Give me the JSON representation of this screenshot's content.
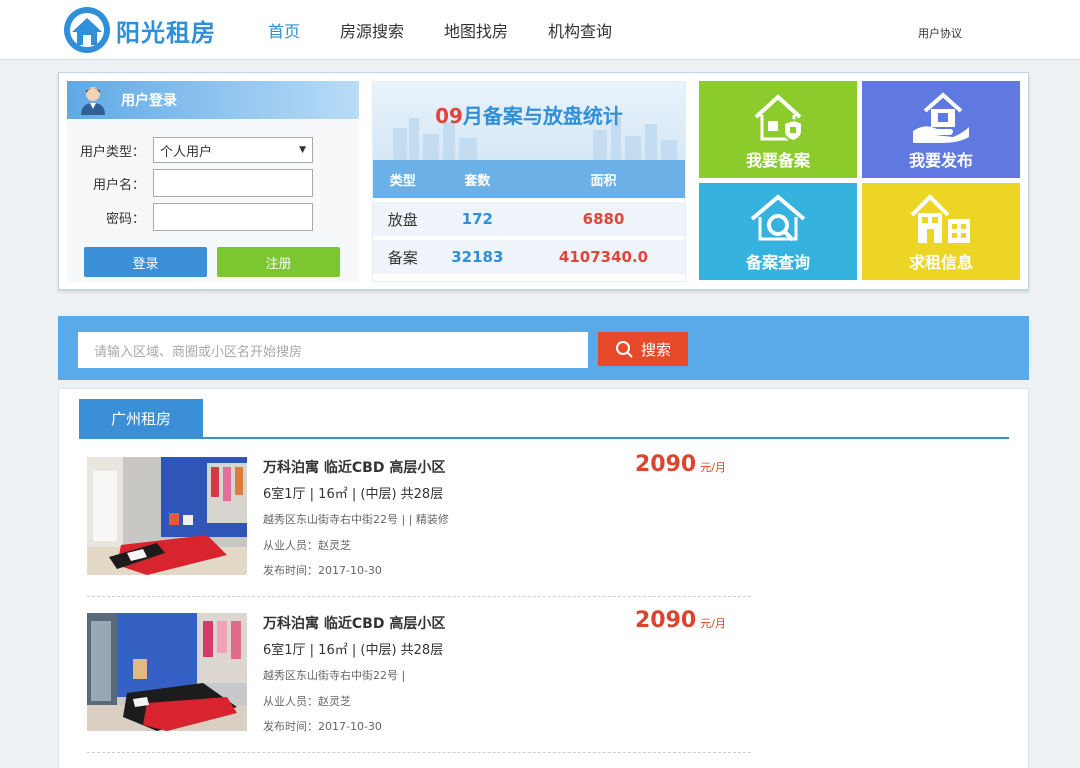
{
  "header": {
    "logo_text": "阳光租房",
    "nav": [
      "首页",
      "房源搜索",
      "地图找房",
      "机构查询"
    ],
    "agreement": "用户协议"
  },
  "login": {
    "title": "用户登录",
    "type_label": "用户类型：",
    "type_value": "个人用户",
    "username_label": "用户名：",
    "password_label": "密码：",
    "login_button": "登录",
    "register_button": "注册"
  },
  "stats": {
    "month": "09",
    "title_rest": "月备案与放盘统计",
    "headers": [
      "类型",
      "套数",
      "面积"
    ],
    "rows": [
      {
        "type": "放盘",
        "count": "172",
        "area": "6880"
      },
      {
        "type": "备案",
        "count": "32183",
        "area": "4107340.0"
      }
    ]
  },
  "tiles": [
    "我要备案",
    "我要发布",
    "备案查询",
    "求租信息"
  ],
  "colors": {
    "brand": "#2f8fd8",
    "accent_red": "#e0473a",
    "tile_green": "#8ccb2c",
    "tile_blue": "#5f79e0",
    "tile_cyan": "#35b2de",
    "tile_yellow": "#ecd524",
    "search_bar": "#5aaaea",
    "search_button": "#e64a2a"
  },
  "search": {
    "placeholder": "请输入区域、商圈或小区名开始搜房",
    "button": "搜索"
  },
  "listing": {
    "tab": "广州租房",
    "items": [
      {
        "title": "万科泊寓 临近CBD 高层小区",
        "spec": "6室1厅 | 16㎡ | (中层) 共28层",
        "addr": "越秀区东山街寺右中街22号 | | 精装修",
        "agent": "从业人员：赵灵芝",
        "date": "发布时间：2017-10-30",
        "price": "2090",
        "unit": "元/月"
      },
      {
        "title": "万科泊寓 临近CBD 高层小区",
        "spec": "6室1厅 | 16㎡ | (中层) 共28层",
        "addr": "越秀区东山街寺右中街22号 |",
        "agent": "从业人员：赵灵芝",
        "date": "发布时间：2017-10-30",
        "price": "2090",
        "unit": "元/月"
      }
    ]
  }
}
